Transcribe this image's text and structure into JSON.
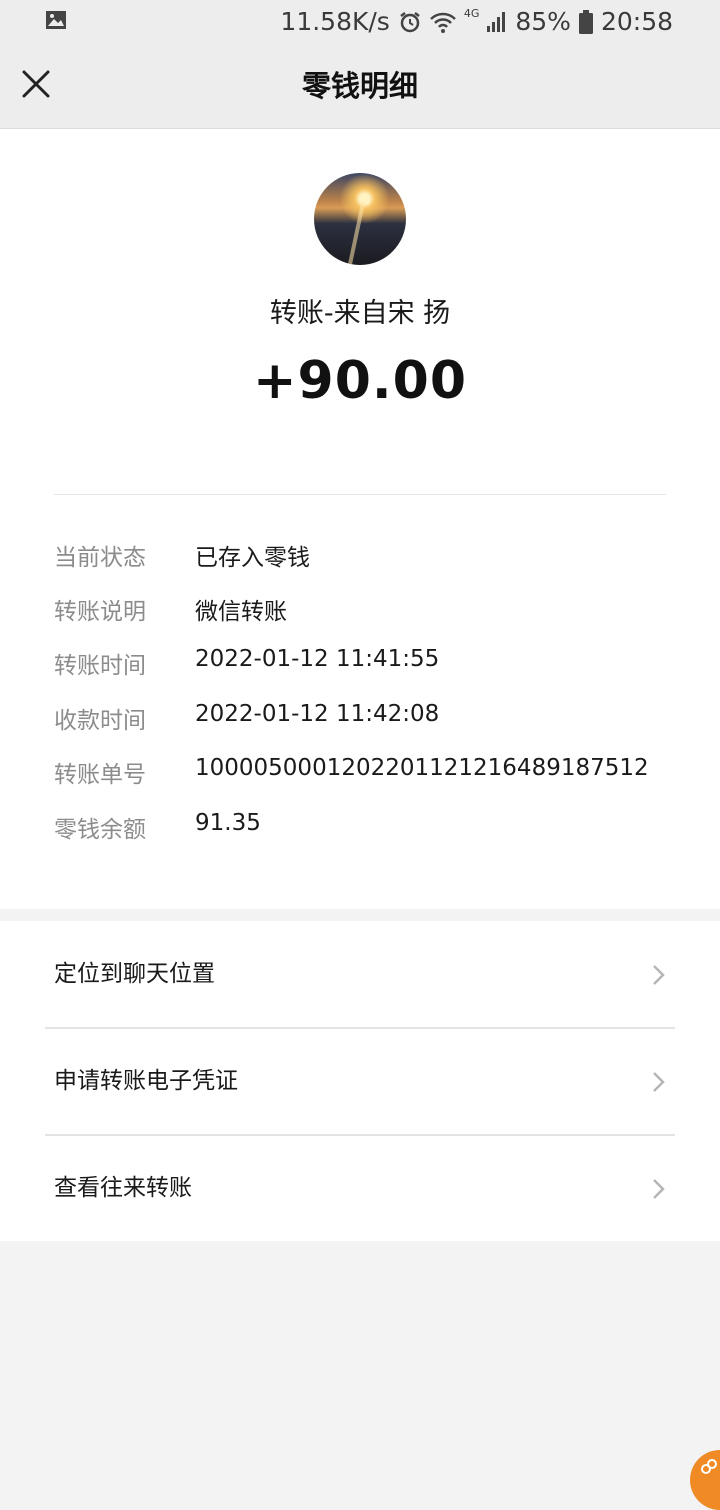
{
  "status_bar": {
    "network_speed": "11.58K/s",
    "network_type": "4G",
    "battery": "85%",
    "time": "20:58"
  },
  "nav": {
    "title": "零钱明细"
  },
  "transfer": {
    "source": "转账-来自宋 扬",
    "amount": "+90.00"
  },
  "details": [
    {
      "label": "当前状态",
      "value": "已存入零钱"
    },
    {
      "label": "转账说明",
      "value": "微信转账"
    },
    {
      "label": "转账时间",
      "value": "2022-01-12 11:41:55"
    },
    {
      "label": "收款时间",
      "value": "2022-01-12 11:42:08"
    },
    {
      "label": "转账单号",
      "value": "100005000120220112121648918751‌2"
    },
    {
      "label": "零钱余额",
      "value": "91.35"
    }
  ],
  "menu": [
    {
      "label": "定位到聊天位置"
    },
    {
      "label": "申请转账电子凭证"
    },
    {
      "label": "查看往来转账"
    }
  ],
  "colors": {
    "float_button": "#f08a24"
  }
}
